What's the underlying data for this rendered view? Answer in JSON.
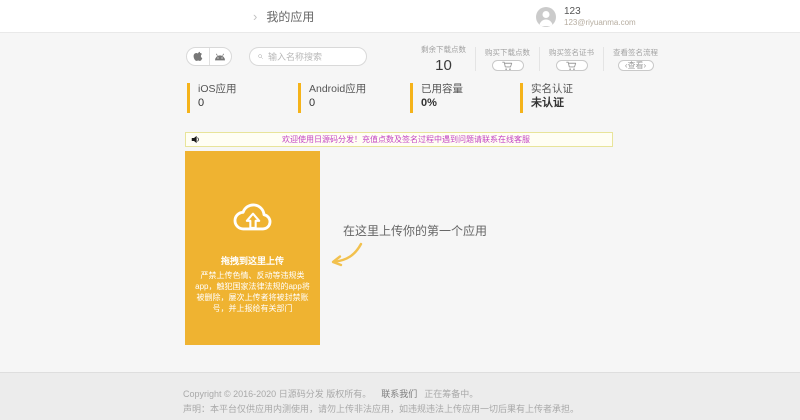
{
  "header": {
    "breadcrumb_chevron": "›",
    "breadcrumb": "我的应用",
    "user": {
      "name": "123",
      "email": "123@riyuanma.com"
    }
  },
  "toolbar": {
    "search_placeholder": "输入名称搜索",
    "stats": [
      {
        "label": "剩余下载点数",
        "value": "10"
      },
      {
        "label": "购买下载点数"
      },
      {
        "label": "购买签名证书"
      },
      {
        "label": "查看签名流程",
        "button": "‹查看›"
      }
    ]
  },
  "stat_cards": [
    {
      "label": "iOS应用",
      "value": "0"
    },
    {
      "label": "Android应用",
      "value": "0"
    },
    {
      "label": "已用容量",
      "value": "0%"
    },
    {
      "label": "实名认证",
      "value": "未认证"
    }
  ],
  "notice": {
    "text": "欢迎使用日源码分发！充值点数及签名过程中遇到问题请联系在线客服"
  },
  "upload_card": {
    "title": "拖拽到这里上传",
    "warning": "严禁上传色情、反动等违规类app，触犯国家法律法规的app将被删除，屡次上传者将被封禁账号，并上报给有关部门"
  },
  "hint": {
    "text": "在这里上传你的第一个应用"
  },
  "footer": {
    "copyright": "Copyright © 2016-2020 日源码分发 版权所有。",
    "contact": "联系我们",
    "status": "正在筹备中。",
    "disclaimer": "声明：本平台仅供应用内测使用，请勿上传非法应用，如违规违法上传应用一切后果有上传者承担。"
  },
  "colors": {
    "accent_yellow": "#EFB331",
    "stat_card_border": "#F5B31A",
    "notice_text": "#C445C4",
    "notice_border": "#E8E49A"
  }
}
